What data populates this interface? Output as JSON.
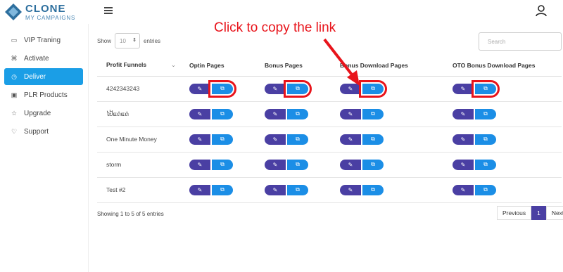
{
  "brand": {
    "name": "CLONE",
    "sub": "MY CAMPAIGNS"
  },
  "sidebar": {
    "items": [
      {
        "label": "VIP Traning",
        "icon": "video-icon"
      },
      {
        "label": "Activate",
        "icon": "command-icon"
      },
      {
        "label": "Deliver",
        "icon": "clock-icon",
        "active": true
      },
      {
        "label": "PLR Products",
        "icon": "box-icon"
      },
      {
        "label": "Upgrade",
        "icon": "star-icon"
      },
      {
        "label": "Support",
        "icon": "heart-icon"
      }
    ]
  },
  "controls": {
    "show_label": "Show",
    "entries_value": "10",
    "entries_label": "entries",
    "search_placeholder": "Search"
  },
  "table": {
    "headers": [
      "Profit Funnels",
      "Optin Pages",
      "Bonus Pages",
      "Bonus Download Pages",
      "OTO Bonus Download Pages"
    ],
    "rows": [
      {
        "name": "4242343243"
      },
      {
        "name": "ໄປ້ແດ່ແດ່"
      },
      {
        "name": "One Minute Money"
      },
      {
        "name": "storm"
      },
      {
        "name": "Test #2"
      }
    ]
  },
  "footer": {
    "info": "Showing 1 to 5 of 5 entries",
    "prev": "Previous",
    "page": "1",
    "next": "Next"
  },
  "annotation": {
    "text": "Click to copy the link",
    "color": "#e8141b"
  },
  "colors": {
    "accent": "#1b9ee6",
    "edit_button": "#4a3fa3",
    "copy_button": "#1b8ee6"
  }
}
